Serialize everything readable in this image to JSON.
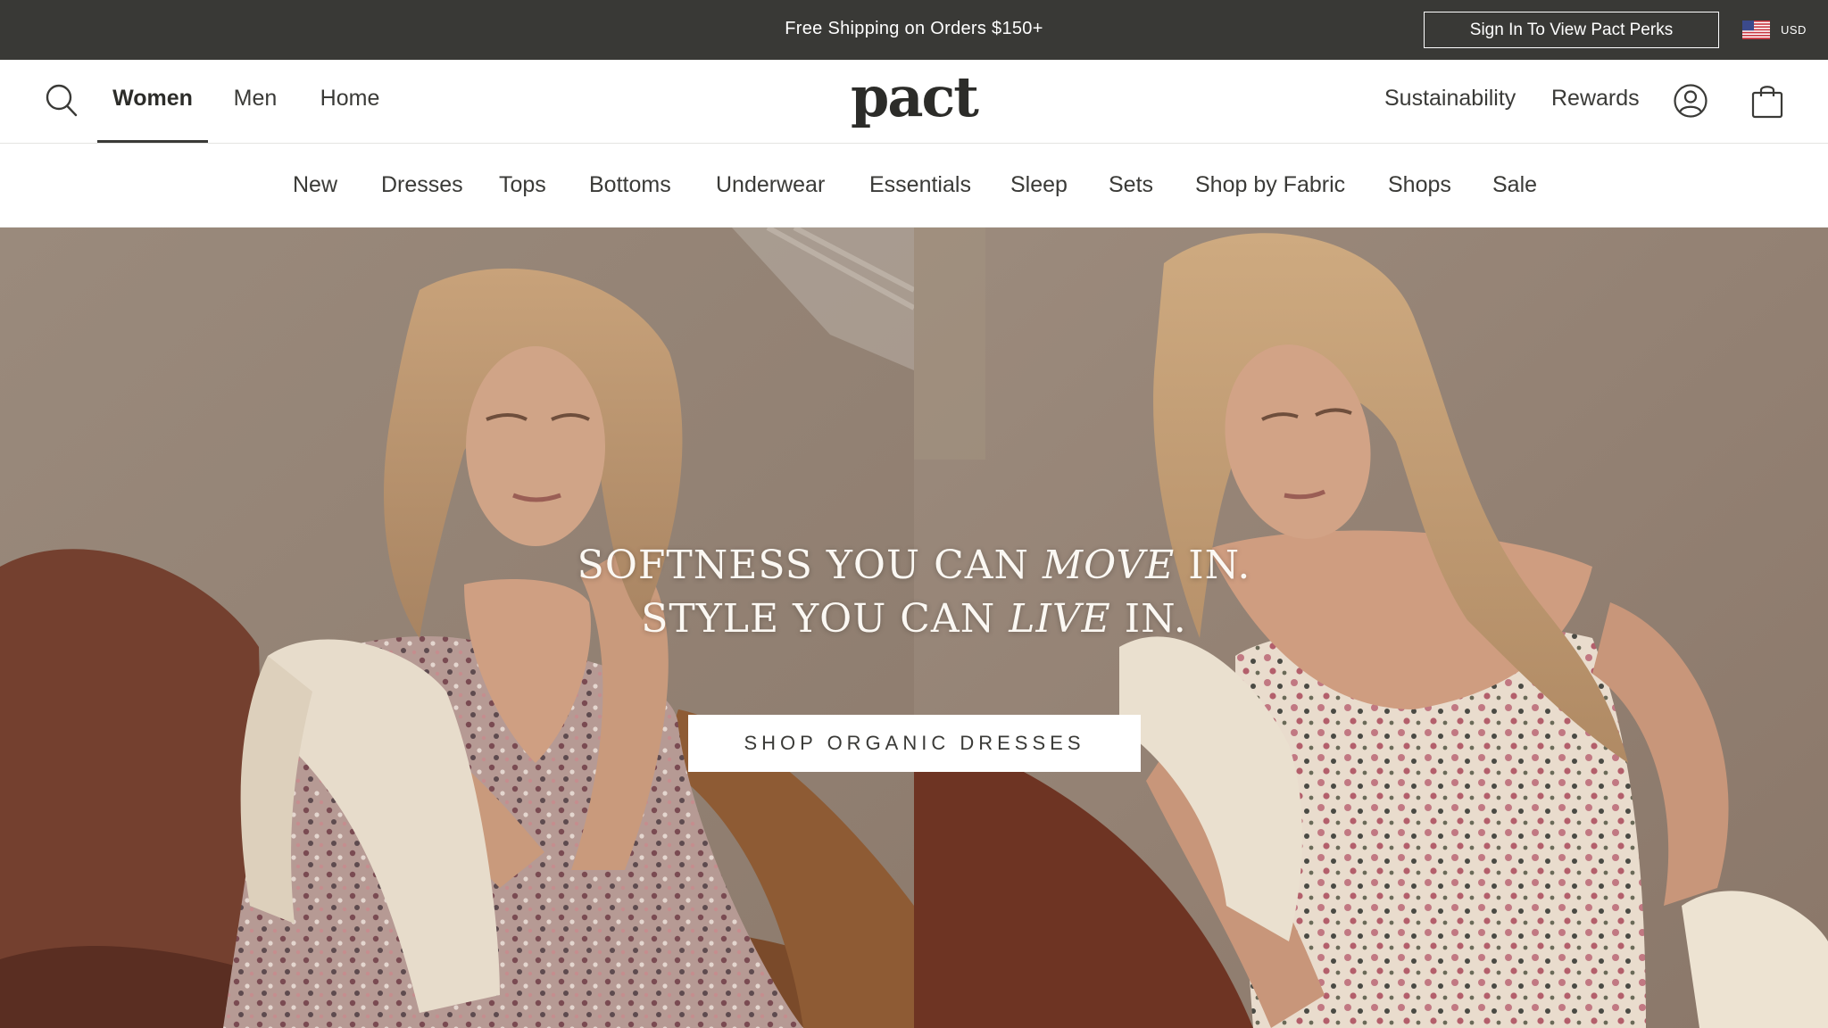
{
  "promo_bar": {
    "text": "Free Shipping on Orders $150+",
    "perks_button": "Sign In To View Pact Perks",
    "currency": "USD",
    "background": "#393936"
  },
  "header": {
    "logo": "pact",
    "departments": [
      {
        "label": "Women",
        "active": true
      },
      {
        "label": "Men",
        "active": false
      },
      {
        "label": "Home",
        "active": false
      }
    ],
    "utility_links": [
      "Sustainability",
      "Rewards"
    ],
    "icons": [
      "search-icon",
      "account-icon",
      "cart-icon"
    ]
  },
  "category_nav": {
    "items": [
      "New",
      "Dresses",
      "Tops",
      "Bottoms",
      "Underwear",
      "Essentials",
      "Sleep",
      "Sets",
      "Shop by Fabric",
      "Shops",
      "Sale"
    ]
  },
  "hero": {
    "headline_line1_pre": "SOFTNESS YOU CAN",
    "headline_line1_em": "MOVE",
    "headline_line1_post": "IN.",
    "headline_line2_pre": "STYLE YOU CAN",
    "headline_line2_em": "LIVE",
    "headline_line2_post": "IN.",
    "cta": "SHOP ORGANIC DRESSES"
  }
}
